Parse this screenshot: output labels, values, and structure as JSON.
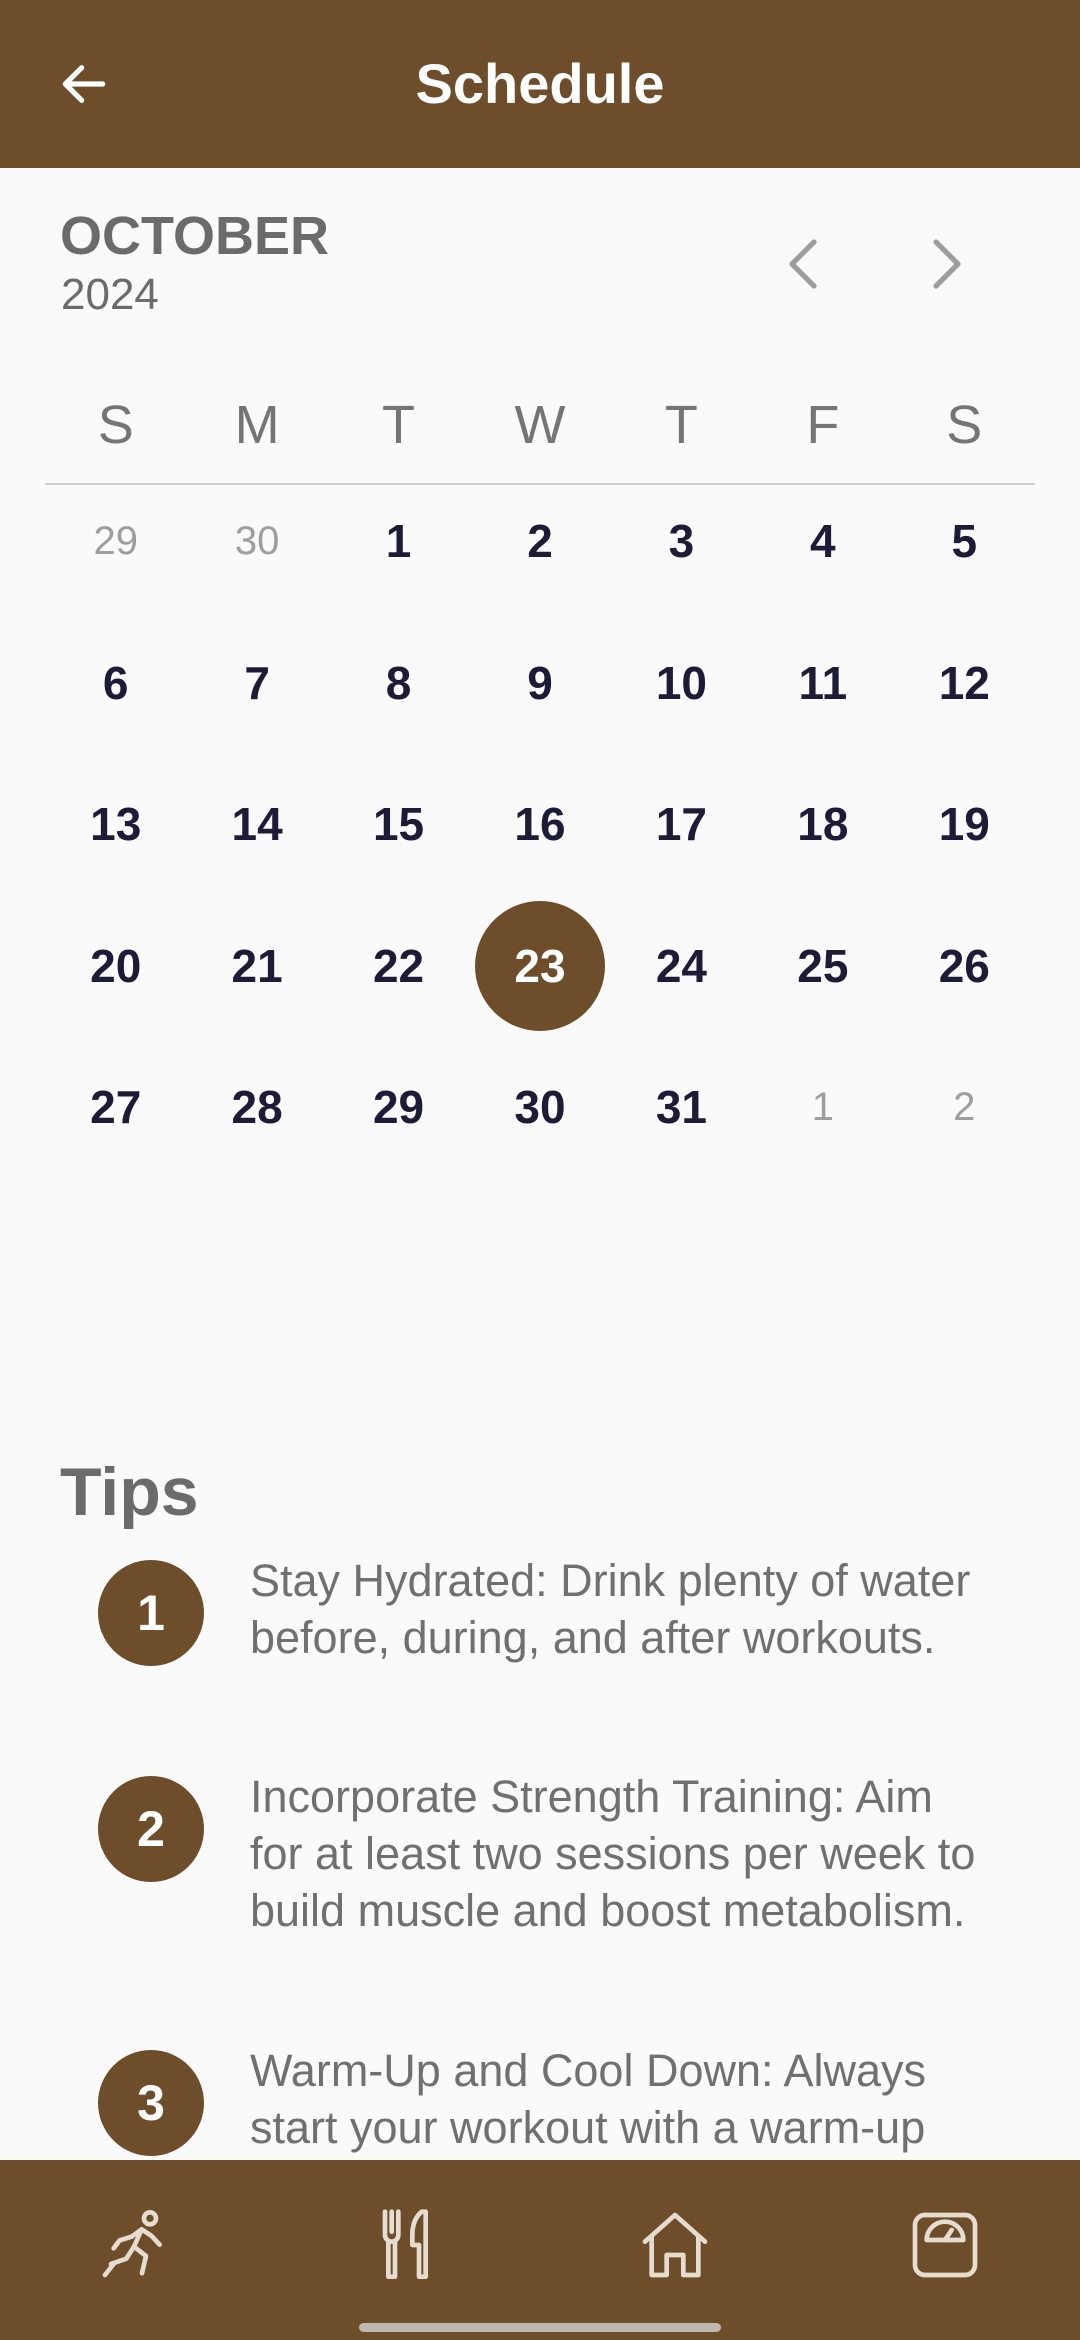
{
  "header": {
    "title": "Schedule",
    "back_icon": "arrow-left-icon"
  },
  "calendar": {
    "month": "OCTOBER",
    "year": "2024",
    "prev_icon": "chevron-left-icon",
    "next_icon": "chevron-right-icon",
    "weekdays": [
      "S",
      "M",
      "T",
      "W",
      "T",
      "F",
      "S"
    ],
    "selected_day": "23",
    "weeks": [
      [
        {
          "d": "29",
          "m": true
        },
        {
          "d": "30",
          "m": true
        },
        {
          "d": "1"
        },
        {
          "d": "2"
        },
        {
          "d": "3"
        },
        {
          "d": "4"
        },
        {
          "d": "5"
        }
      ],
      [
        {
          "d": "6"
        },
        {
          "d": "7"
        },
        {
          "d": "8"
        },
        {
          "d": "9"
        },
        {
          "d": "10"
        },
        {
          "d": "11"
        },
        {
          "d": "12"
        }
      ],
      [
        {
          "d": "13"
        },
        {
          "d": "14"
        },
        {
          "d": "15"
        },
        {
          "d": "16"
        },
        {
          "d": "17"
        },
        {
          "d": "18"
        },
        {
          "d": "19"
        }
      ],
      [
        {
          "d": "20"
        },
        {
          "d": "21"
        },
        {
          "d": "22"
        },
        {
          "d": "23",
          "sel": true
        },
        {
          "d": "24"
        },
        {
          "d": "25"
        },
        {
          "d": "26"
        }
      ],
      [
        {
          "d": "27"
        },
        {
          "d": "28"
        },
        {
          "d": "29"
        },
        {
          "d": "30"
        },
        {
          "d": "31"
        },
        {
          "d": "1",
          "m": true
        },
        {
          "d": "2",
          "m": true
        }
      ]
    ]
  },
  "tips": {
    "title": "Tips",
    "items": [
      {
        "num": "1",
        "text": "Stay Hydrated: Drink plenty of water before, during, and after workouts."
      },
      {
        "num": "2",
        "text": "Incorporate Strength Training: Aim for at least two sessions per week to build muscle and boost metabolism."
      },
      {
        "num": "3",
        "text": "Warm-Up and Cool Down: Always start your workout with a warm-up"
      }
    ]
  },
  "bottom_nav": {
    "items": [
      {
        "icon": "running-icon"
      },
      {
        "icon": "fork-knife-icon"
      },
      {
        "icon": "home-icon"
      },
      {
        "icon": "scale-icon"
      }
    ]
  },
  "colors": {
    "brand": "#6e4e2a",
    "background": "#fafafa",
    "day_text": "#1d1b36",
    "muted_text": "#9e9e9e"
  }
}
